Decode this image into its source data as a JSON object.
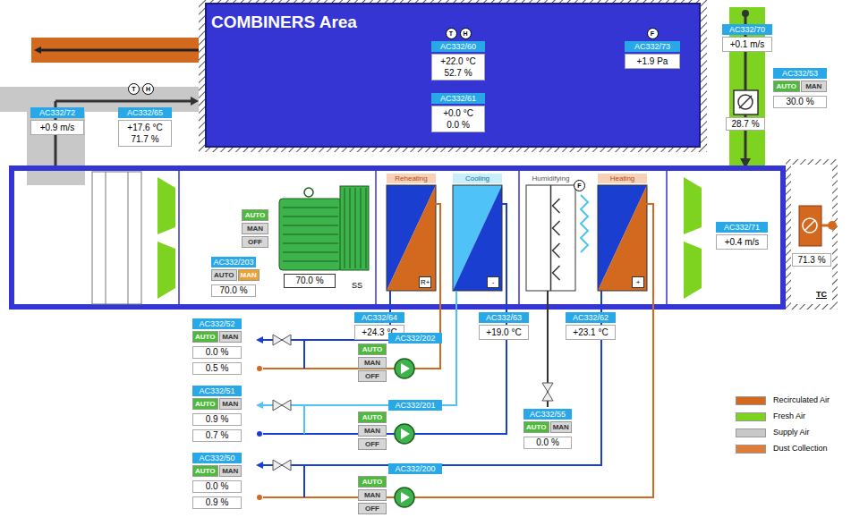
{
  "area": {
    "title": "COMBINERS Area"
  },
  "room_sensors": [
    {
      "tag": "AC332/60",
      "icons": [
        "T",
        "H"
      ],
      "values": [
        "+22.0 °C",
        "52.7 %"
      ]
    },
    {
      "tag": "AC332/61",
      "icons": [],
      "values": [
        "+0.0 °C",
        "0.0 %"
      ]
    },
    {
      "tag": "AC332/73",
      "icons": [
        "F"
      ],
      "values": [
        "+1.9 Pa"
      ]
    }
  ],
  "supply_duct": {
    "velocity": {
      "tag": "AC332/72",
      "values": [
        "+0.9 m/s"
      ]
    },
    "climate": {
      "tag": "AC332/65",
      "icons": [
        "T",
        "H"
      ],
      "values": [
        "+17.6 °C",
        "71.7 %"
      ]
    }
  },
  "fresh_air": {
    "velocity": {
      "tag": "AC332/70",
      "values": [
        "+0.1 m/s"
      ]
    },
    "damper_reading": "28.7 %",
    "control": {
      "tag": "AC332/53",
      "modes": [
        {
          "label": "AUTO",
          "selected": true
        },
        {
          "label": "MAN",
          "selected": false
        }
      ],
      "values": [
        "30.0 %"
      ]
    }
  },
  "recirculation": {
    "velocity": {
      "tag": "AC332/71",
      "values": [
        "+0.4 m/s"
      ]
    },
    "damper_reading": "71.3 %",
    "label": "TC"
  },
  "fan": {
    "switch": [
      {
        "label": "AUTO",
        "selected": true
      },
      {
        "label": "MAN",
        "selected": false
      },
      {
        "label": "OFF",
        "selected": false
      }
    ],
    "control": {
      "tag": "AC332/203",
      "modes": [
        {
          "label": "AUTO",
          "selected": false
        },
        {
          "label": "MAN",
          "selected": true
        }
      ],
      "values": [
        "70.0 %"
      ]
    },
    "speed": "70.0 %",
    "label": "SS"
  },
  "coils": [
    {
      "name": "Reheating",
      "kind": "heat",
      "sign": "R+"
    },
    {
      "name": "Cooling",
      "kind": "cool",
      "sign": "-"
    },
    {
      "name": "Humidifying",
      "kind": "humidifier",
      "sensor": "F"
    },
    {
      "name": "Heating",
      "kind": "heat",
      "sign": "+"
    }
  ],
  "temperatures": [
    {
      "tag": "AC332/64",
      "values": [
        "+24.3 °C"
      ]
    },
    {
      "tag": "AC332/63",
      "values": [
        "+19.0 °C"
      ]
    },
    {
      "tag": "AC332/62",
      "values": [
        "+23.1 °C"
      ]
    }
  ],
  "loops": [
    {
      "kind": "hot",
      "valve": {
        "tag": "AC332/52",
        "modes": [
          {
            "label": "AUTO",
            "selected": true
          },
          {
            "label": "MAN",
            "selected": false
          }
        ],
        "values": [
          "0.0 %",
          "0.5 %"
        ]
      },
      "pump": {
        "tag": "AC332/202",
        "modes": [
          {
            "label": "AUTO",
            "selected": true
          },
          {
            "label": "MAN",
            "selected": false
          },
          {
            "label": "OFF",
            "selected": false
          }
        ]
      }
    },
    {
      "kind": "cold",
      "valve": {
        "tag": "AC332/51",
        "modes": [
          {
            "label": "AUTO",
            "selected": true
          },
          {
            "label": "MAN",
            "selected": false
          }
        ],
        "values": [
          "0.9 %",
          "0.7 %"
        ]
      },
      "pump": {
        "tag": "AC332/201",
        "modes": [
          {
            "label": "AUTO",
            "selected": true
          },
          {
            "label": "MAN",
            "selected": false
          },
          {
            "label": "OFF",
            "selected": false
          }
        ]
      }
    },
    {
      "kind": "hot",
      "valve": {
        "tag": "AC332/50",
        "modes": [
          {
            "label": "AUTO",
            "selected": true
          },
          {
            "label": "MAN",
            "selected": false
          }
        ],
        "values": [
          "0.0 %",
          "0.9 %"
        ]
      },
      "pump": {
        "tag": "AC332/200",
        "modes": [
          {
            "label": "AUTO",
            "selected": true
          },
          {
            "label": "MAN",
            "selected": false
          },
          {
            "label": "OFF",
            "selected": false
          }
        ]
      }
    }
  ],
  "humidifier_valve": {
    "tag": "AC332/55",
    "modes": [
      {
        "label": "AUTO",
        "selected": true
      },
      {
        "label": "MAN",
        "selected": false
      }
    ],
    "values": [
      "0.0 %"
    ]
  },
  "legend": [
    {
      "label": "Recirculated Air",
      "color": "#d2691e"
    },
    {
      "label": "Fresh Air",
      "color": "#7ed321"
    },
    {
      "label": "Supply Air",
      "color": "#c8c8c8"
    },
    {
      "label": "Dust Collection",
      "color": "#e07b39"
    }
  ]
}
